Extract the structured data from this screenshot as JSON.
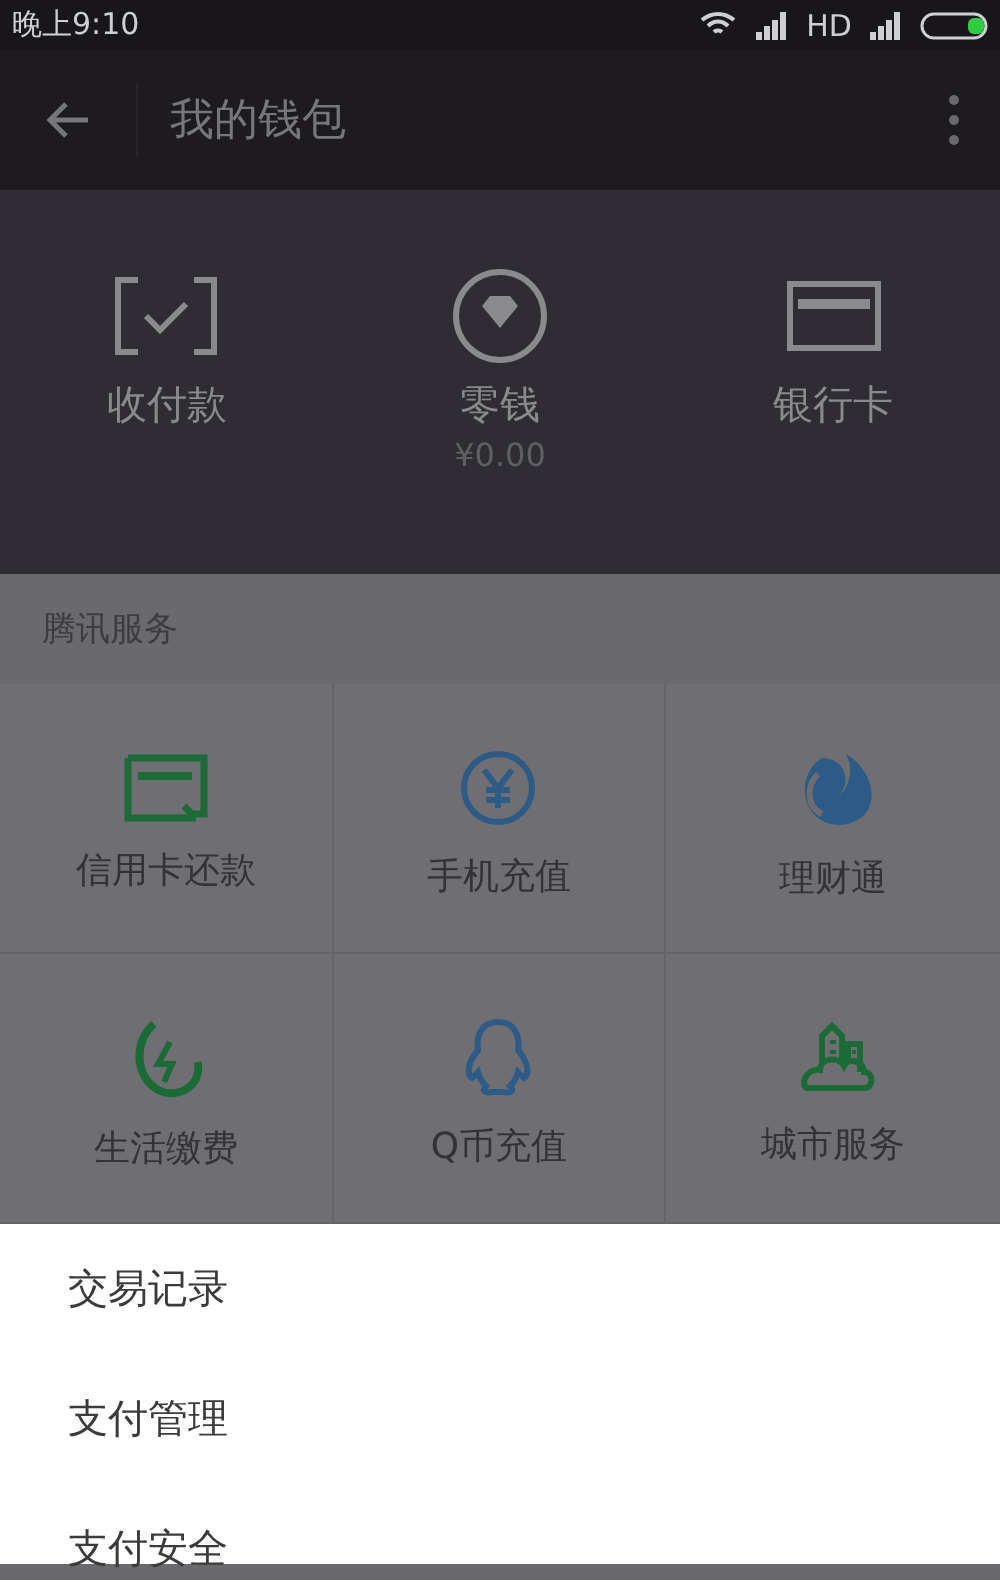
{
  "status_bar": {
    "time": "晚上9:10",
    "network": "HD"
  },
  "app_bar": {
    "title": "我的钱包"
  },
  "wallet_actions": [
    {
      "label": "收付款"
    },
    {
      "label": "零钱",
      "amount": "¥0.00"
    },
    {
      "label": "银行卡"
    }
  ],
  "services": {
    "title": "腾讯服务",
    "items": [
      {
        "label": "信用卡还款"
      },
      {
        "label": "手机充值"
      },
      {
        "label": "理财通"
      },
      {
        "label": "生活缴费"
      },
      {
        "label": "Q币充值"
      },
      {
        "label": "城市服务"
      }
    ]
  },
  "menu": {
    "items": [
      "交易记录",
      "支付管理",
      "支付安全"
    ]
  }
}
